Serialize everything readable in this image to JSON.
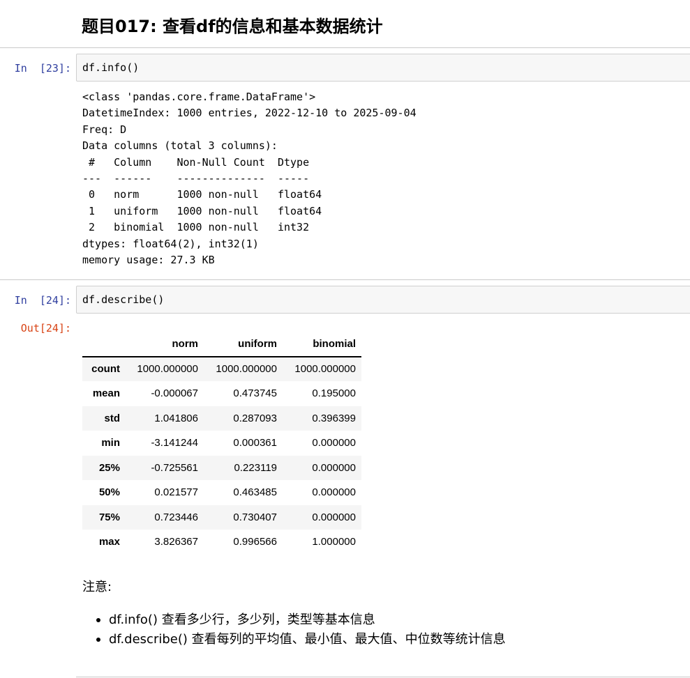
{
  "heading": "题目017: 查看df的信息和基本数据统计",
  "cells": [
    {
      "prompt": "In  [23]:",
      "code": "df.info()",
      "output_lines": [
        "<class 'pandas.core.frame.DataFrame'>",
        "DatetimeIndex: 1000 entries, 2022-12-10 to 2025-09-04",
        "Freq: D",
        "Data columns (total 3 columns):",
        " #   Column    Non-Null Count  Dtype  ",
        "---  ------    --------------  -----  ",
        " 0   norm      1000 non-null   float64",
        " 1   uniform   1000 non-null   float64",
        " 2   binomial  1000 non-null   int32  ",
        "dtypes: float64(2), int32(1)",
        "memory usage: 27.3 KB"
      ]
    },
    {
      "prompt": "In  [24]:",
      "code": "df.describe()",
      "out_prompt": "Out[24]:"
    }
  ],
  "describe_table": {
    "columns": [
      "",
      "norm",
      "uniform",
      "binomial"
    ],
    "rows": [
      {
        "index": "count",
        "values": [
          "1000.000000",
          "1000.000000",
          "1000.000000"
        ]
      },
      {
        "index": "mean",
        "values": [
          "-0.000067",
          "0.473745",
          "0.195000"
        ]
      },
      {
        "index": "std",
        "values": [
          "1.041806",
          "0.287093",
          "0.396399"
        ]
      },
      {
        "index": "min",
        "values": [
          "-3.141244",
          "0.000361",
          "0.000000"
        ]
      },
      {
        "index": "25%",
        "values": [
          "-0.725561",
          "0.223119",
          "0.000000"
        ]
      },
      {
        "index": "50%",
        "values": [
          "0.021577",
          "0.463485",
          "0.000000"
        ]
      },
      {
        "index": "75%",
        "values": [
          "0.723446",
          "0.730407",
          "0.000000"
        ]
      },
      {
        "index": "max",
        "values": [
          "3.826367",
          "0.996566",
          "1.000000"
        ]
      }
    ]
  },
  "notes": {
    "label": "注意:",
    "items": [
      "df.info() 查看多少行，多少列，类型等基本信息",
      "df.describe() 查看每列的平均值、最小值、最大值、中位数等统计信息"
    ]
  },
  "colors": {
    "in_prompt": "#303f9f",
    "out_prompt": "#d84315",
    "input_bg": "#f7f7f7",
    "input_border": "#cfcfcf"
  }
}
